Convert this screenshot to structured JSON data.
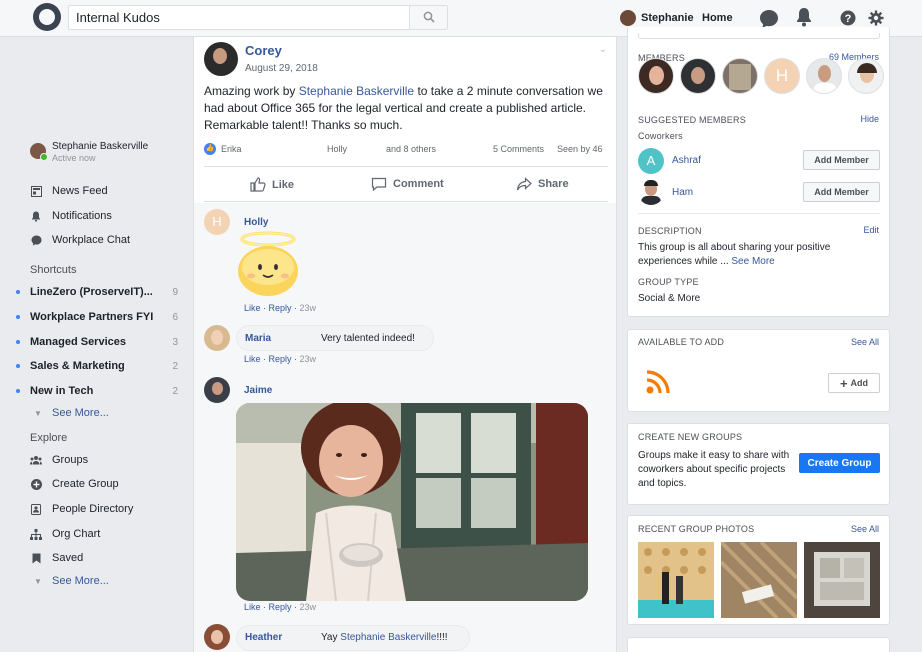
{
  "topbar": {
    "search_value": "Internal Kudos",
    "user_name": "Stephanie",
    "home_label": "Home",
    "icons": [
      "search-icon",
      "chat-icon",
      "bell-icon",
      "help-icon",
      "gear-icon"
    ]
  },
  "sidebar": {
    "me": {
      "name": "Stephanie Baskerville",
      "status": "Active now"
    },
    "nav": [
      {
        "label": "News Feed",
        "icon": "news-feed-icon"
      },
      {
        "label": "Notifications",
        "icon": "bell-icon"
      },
      {
        "label": "Workplace Chat",
        "icon": "chat-icon"
      }
    ],
    "shortcuts_title": "Shortcuts",
    "shortcuts": [
      {
        "label": "LineZero (ProserveIT)...",
        "count": "9"
      },
      {
        "label": "Workplace Partners FYI",
        "count": "6"
      },
      {
        "label": "Managed Services",
        "count": "3"
      },
      {
        "label": "Sales & Marketing",
        "count": "2"
      },
      {
        "label": "New in Tech",
        "count": "2"
      }
    ],
    "see_more": "See More...",
    "explore_title": "Explore",
    "explore": [
      {
        "label": "Groups",
        "icon": "groups-icon"
      },
      {
        "label": "Create Group",
        "icon": "plus-circle-icon"
      },
      {
        "label": "People Directory",
        "icon": "people-directory-icon"
      },
      {
        "label": "Org Chart",
        "icon": "org-chart-icon"
      },
      {
        "label": "Saved",
        "icon": "bookmark-icon"
      }
    ],
    "explore_see_more": "See More..."
  },
  "post": {
    "author": "Corey",
    "date": "August 29, 2018",
    "body_pre": "Amazing work by ",
    "body_link": "Stephanie Baskerville",
    "body_post": " to take a 2 minute conversation we had about Office 365 for the legal vertical and create a published article. Remarkable talent!! Thanks so much.",
    "reactions": {
      "first": "Erika",
      "second": "Holly",
      "others": "and 8 others"
    },
    "comments_count": "5 Comments",
    "seen_by": "Seen by 46",
    "actions": {
      "like": "Like",
      "comment": "Comment",
      "share": "Share"
    }
  },
  "comments": [
    {
      "name": "Holly",
      "initial": "H",
      "text": "",
      "like": "Like",
      "reply": "Reply",
      "time": "23w"
    },
    {
      "name": "Maria",
      "text": "Very talented indeed!",
      "like": "Like",
      "reply": "Reply",
      "time": "23w"
    },
    {
      "name": "Jaime",
      "text": "",
      "like": "Like",
      "reply": "Reply",
      "time": "23w"
    },
    {
      "name": "Heather",
      "text_pre": "Yay ",
      "text_link": "Stephanie Baskerville",
      "text_post": "!!!!"
    }
  ],
  "right": {
    "members": {
      "title": "MEMBERS",
      "count_label": "69 Members"
    },
    "suggested": {
      "title": "SUGGESTED MEMBERS",
      "hide": "Hide",
      "subtitle": "Coworkers",
      "people": [
        {
          "name": "Ashraf",
          "initial": "A",
          "button": "Add Member"
        },
        {
          "name": "Ham",
          "button": "Add Member"
        }
      ]
    },
    "description": {
      "title": "DESCRIPTION",
      "edit": "Edit",
      "text": "This group is all about sharing your positive experiences while ...",
      "see_more": "See More"
    },
    "group_type": {
      "title": "GROUP TYPE",
      "value": "Social & More"
    },
    "available": {
      "title": "AVAILABLE TO ADD",
      "see_all": "See All",
      "add_label": "Add"
    },
    "create": {
      "title": "CREATE NEW GROUPS",
      "text": "Groups make it easy to share with coworkers about specific projects and topics.",
      "button": "Create Group"
    },
    "photos": {
      "title": "RECENT GROUP PHOTOS",
      "see_all": "See All"
    }
  },
  "colors": {
    "accent": "#1877f2",
    "link": "#365899",
    "online": "#42b72a",
    "rss": "#f57c00"
  }
}
